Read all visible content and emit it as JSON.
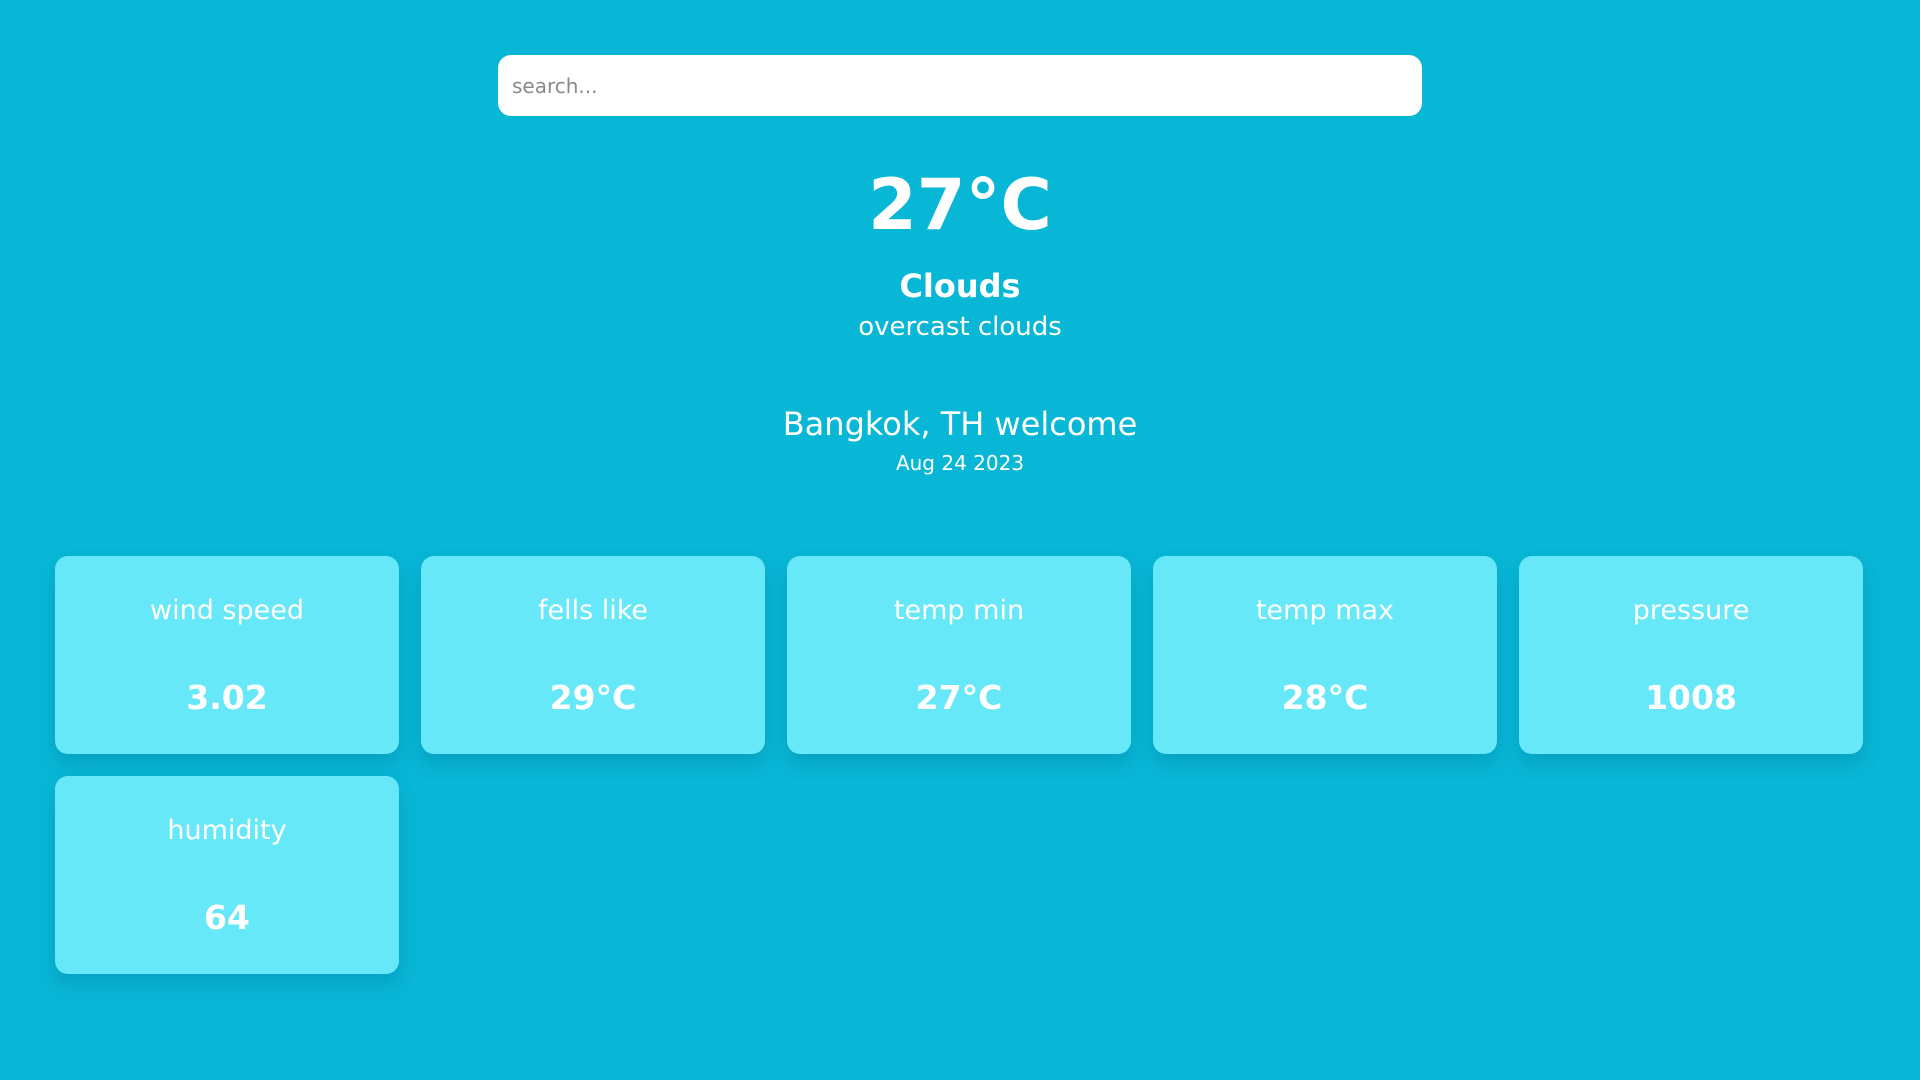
{
  "search": {
    "placeholder": "search...",
    "value": ""
  },
  "weather": {
    "temperature": "27°C",
    "condition": "Clouds",
    "description": "overcast clouds"
  },
  "location": {
    "text": "Bangkok, TH welcome",
    "date": "Aug 24 2023"
  },
  "cards": [
    {
      "label": "wind speed",
      "value": "3.02"
    },
    {
      "label": "fells like",
      "value": "29°C"
    },
    {
      "label": "temp min",
      "value": "27°C"
    },
    {
      "label": "temp max",
      "value": "28°C"
    },
    {
      "label": "pressure",
      "value": "1008"
    },
    {
      "label": "humidity",
      "value": "64"
    }
  ],
  "colors": {
    "background": "#08b6d6",
    "card": "#67e8f9",
    "text": "#ffffff"
  }
}
